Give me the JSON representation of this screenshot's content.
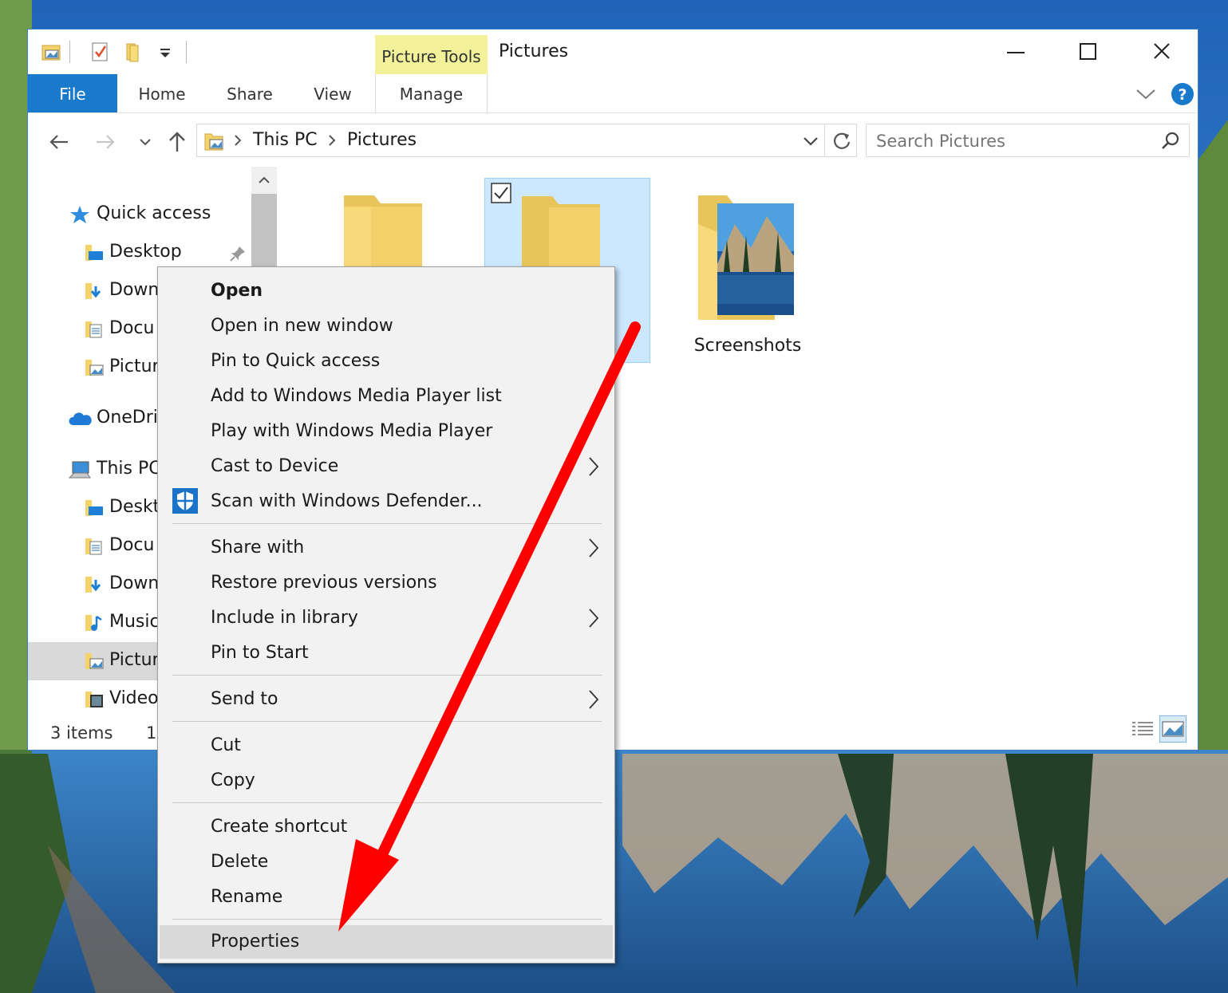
{
  "window": {
    "title": "Pictures",
    "contextual_tab_group": "Picture Tools"
  },
  "ribbon": {
    "tabs": [
      {
        "label": "File"
      },
      {
        "label": "Home"
      },
      {
        "label": "Share"
      },
      {
        "label": "View"
      },
      {
        "label": "Manage"
      }
    ]
  },
  "address": {
    "crumbs": [
      "This PC",
      "Pictures"
    ],
    "search_placeholder": "Search Pictures"
  },
  "nav_pane": {
    "items": [
      {
        "label": "Quick access",
        "icon": "star-icon"
      },
      {
        "label": "Desktop",
        "icon": "desktop-folder-icon",
        "pinned": true
      },
      {
        "label": "Down",
        "icon": "downloads-folder-icon"
      },
      {
        "label": "Docu",
        "icon": "documents-folder-icon"
      },
      {
        "label": "Pictur",
        "icon": "pictures-folder-icon"
      },
      {
        "label": "OneDri",
        "icon": "cloud-icon"
      },
      {
        "label": "This PC",
        "icon": "computer-icon"
      },
      {
        "label": "Deskt",
        "icon": "desktop-folder-icon"
      },
      {
        "label": "Docu",
        "icon": "documents-folder-icon"
      },
      {
        "label": "Down",
        "icon": "downloads-folder-icon"
      },
      {
        "label": "Music",
        "icon": "music-folder-icon"
      },
      {
        "label": "Pictur",
        "icon": "pictures-folder-icon",
        "selected": true
      },
      {
        "label": "Video",
        "icon": "videos-folder-icon"
      }
    ]
  },
  "content": {
    "folders": [
      {
        "label": "",
        "selected": false
      },
      {
        "label": "",
        "selected": true,
        "checked": true
      },
      {
        "label": "Screenshots",
        "selected": false
      }
    ]
  },
  "status_bar": {
    "item_count": "3 items",
    "selected_fragment": "1"
  },
  "context_menu": {
    "items": [
      {
        "label": "Open",
        "bold": true
      },
      {
        "label": "Open in new window"
      },
      {
        "label": "Pin to Quick access"
      },
      {
        "label": "Add to Windows Media Player list"
      },
      {
        "label": "Play with Windows Media Player"
      },
      {
        "label": "Cast to Device",
        "submenu": true
      },
      {
        "label": "Scan with Windows Defender...",
        "icon": "shield-icon"
      },
      {
        "label": "Share with",
        "submenu": true
      },
      {
        "label": "Restore previous versions"
      },
      {
        "label": "Include in library",
        "submenu": true
      },
      {
        "label": "Pin to Start"
      },
      {
        "label": "Send to",
        "submenu": true
      },
      {
        "label": "Cut"
      },
      {
        "label": "Copy"
      },
      {
        "label": "Create shortcut"
      },
      {
        "label": "Delete"
      },
      {
        "label": "Rename"
      },
      {
        "label": "Properties",
        "highlighted": true
      }
    ]
  },
  "colors": {
    "file_tab": "#1979ca",
    "contextual_tab": "#f3f19a",
    "selection_fill": "#cce8ff",
    "annotation_arrow": "#ff0000"
  }
}
